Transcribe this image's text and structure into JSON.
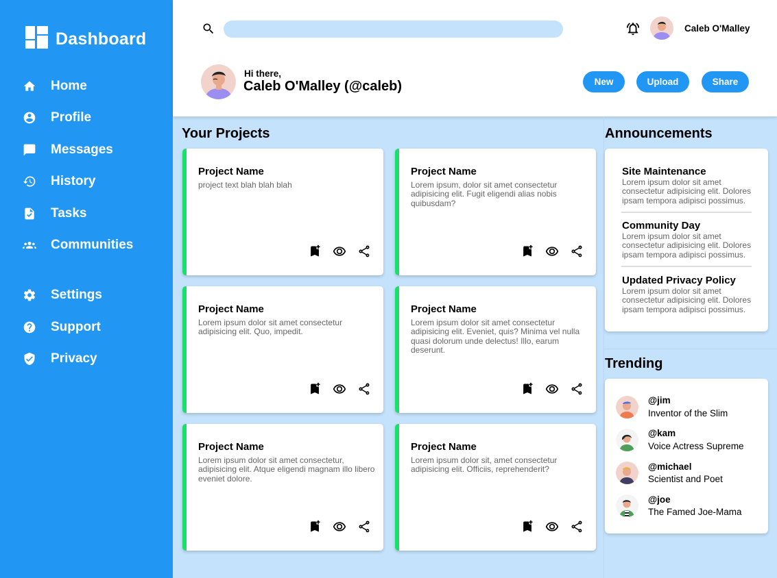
{
  "sidebar": {
    "brand_title": "Dashboard",
    "brand_icon": "dashboard-icon",
    "items": [
      {
        "label": "Home",
        "icon": "home-icon"
      },
      {
        "label": "Profile",
        "icon": "profile-icon"
      },
      {
        "label": "Messages",
        "icon": "messages-icon"
      },
      {
        "label": "History",
        "icon": "history-icon"
      },
      {
        "label": "Tasks",
        "icon": "tasks-icon"
      },
      {
        "label": "Communities",
        "icon": "communities-icon"
      },
      {
        "label": "Settings",
        "icon": "settings-icon"
      },
      {
        "label": "Support",
        "icon": "support-icon"
      },
      {
        "label": "Privacy",
        "icon": "privacy-icon"
      }
    ]
  },
  "header": {
    "search_placeholder": "",
    "username": "Caleb O'Malley",
    "greeting": "Hi there,",
    "hero_name": "Caleb O'Malley (@caleb)",
    "buttons": [
      "New",
      "Upload",
      "Share"
    ]
  },
  "projects": {
    "title": "Your Projects",
    "cards": [
      {
        "name": "Project Name",
        "text": "project text blah blah blah"
      },
      {
        "name": "Project Name",
        "text": "Lorem ipsum, dolor sit amet consectetur adipisicing elit. Fugit eligendi alias nobis quibusdam?"
      },
      {
        "name": "Project Name",
        "text": "Lorem ipsum dolor sit amet consectetur adipisicing elit. Quo, impedit."
      },
      {
        "name": "Project Name",
        "text": "Lorem ipsum dolor sit amet consectetur adipisicing elit. Eveniet, quis? Minima vel nulla quasi dolorum unde delectus! Illo, earum deserunt."
      },
      {
        "name": "Project Name",
        "text": "Lorem ipsum dolor sit amet consectetur, adipisicing elit. Atque eligendi magnam illo libero eveniet dolore."
      },
      {
        "name": "Project Name",
        "text": "Lorem ipsum dolor sit, amet consectetur adipisicing elit. Officiis, reprehenderit?"
      }
    ]
  },
  "announcements": {
    "title": "Announcements",
    "items": [
      {
        "title": "Site Maintenance",
        "text": "Lorem ipsum dolor sit amet consectetur adipisicing elit. Dolores ipsam tempora adipisci possimus."
      },
      {
        "title": "Community Day",
        "text": "Lorem ipsum dolor sit amet consectetur adipisicing elit. Dolores ipsam tempora adipisci possimus."
      },
      {
        "title": "Updated Privacy Policy",
        "text": "Lorem ipsum dolor sit amet consectetur adipisicing elit. Dolores ipsam tempora adipisci possimus."
      }
    ]
  },
  "trending": {
    "title": "Trending",
    "items": [
      {
        "handle": "@jim",
        "desc": "Inventor of the Slim"
      },
      {
        "handle": "@kam",
        "desc": "Voice Actress Supreme"
      },
      {
        "handle": "@michael",
        "desc": "Scientist and Poet"
      },
      {
        "handle": "@joe",
        "desc": "The Famed Joe-Mama"
      }
    ]
  },
  "colors": {
    "accent": "#2196f3",
    "background": "#c4e2fb",
    "card_accent": "#18e06a"
  }
}
